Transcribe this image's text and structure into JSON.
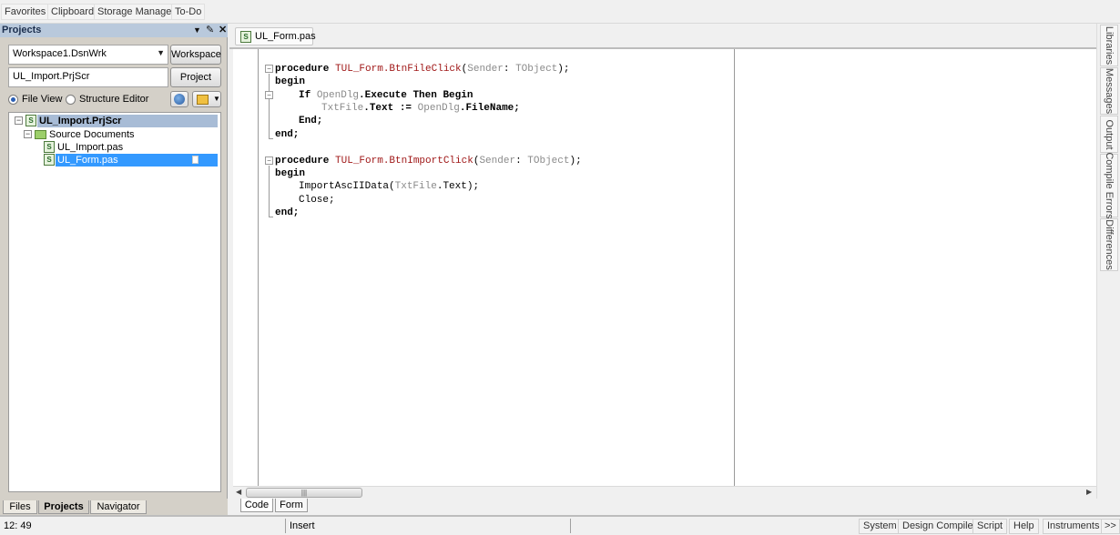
{
  "top_tabs": [
    "Favorites",
    "Clipboard",
    "Storage Manager",
    "To-Do"
  ],
  "projects_panel": {
    "title": "Projects",
    "header_icons": [
      "dropdown-icon",
      "pin-icon",
      "close-icon"
    ],
    "workspace_combo": "Workspace1.DsnWrk",
    "workspace_button": "Workspace",
    "project_field": "UL_Import.PrjScr",
    "project_button": "Project",
    "view_options": [
      {
        "label": "File View",
        "selected": true
      },
      {
        "label": "Structure Editor",
        "selected": false
      }
    ],
    "tree": {
      "project": "UL_Import.PrjScr",
      "folder": "Source Documents",
      "files": [
        {
          "name": "UL_Import.pas",
          "selected": false
        },
        {
          "name": "UL_Form.pas",
          "selected": true
        }
      ]
    },
    "bottom_tabs": [
      {
        "label": "Files",
        "active": false
      },
      {
        "label": "Projects",
        "active": true
      },
      {
        "label": "Navigator",
        "active": false
      }
    ]
  },
  "editor": {
    "document_tab": "UL_Form.pas",
    "code": {
      "l1": {
        "kw": "procedure ",
        "name": "TUL_Form.BtnFileClick",
        "p1": "(",
        "arg": "Sender",
        "p2": ": ",
        "type": "TObject",
        "end": ");"
      },
      "l2": "begin",
      "l3": {
        "kw1": "If ",
        "obj": "OpenDlg",
        "rest": ".Execute Then Begin"
      },
      "l4": {
        "obj": "TxtFile",
        "mid": ".Text := ",
        "obj2": "OpenDlg",
        "rest": ".FileName;"
      },
      "l5": "End;",
      "l6": "end;",
      "l8": {
        "kw": "procedure ",
        "name": "TUL_Form.BtnImportClick",
        "p1": "(",
        "arg": "Sender",
        "p2": ": ",
        "type": "TObject",
        "end": ");"
      },
      "l9": "begin",
      "l10": {
        "pre": "ImportAscIIData(",
        "obj": "TxtFile",
        "rest": ".Text);"
      },
      "l11": "Close;",
      "l12": "end;"
    },
    "view_tabs": [
      {
        "label": "Code",
        "active": true
      },
      {
        "label": "Form",
        "active": false
      }
    ]
  },
  "side_panels": [
    "Libraries",
    "Messages",
    "Output",
    "Compile Errors",
    "Differences"
  ],
  "status_bar": {
    "position": "12: 49",
    "mode": "Insert",
    "buttons": [
      "System",
      "Design Compiler",
      "Script",
      "Help",
      "Instruments",
      ">>"
    ]
  }
}
